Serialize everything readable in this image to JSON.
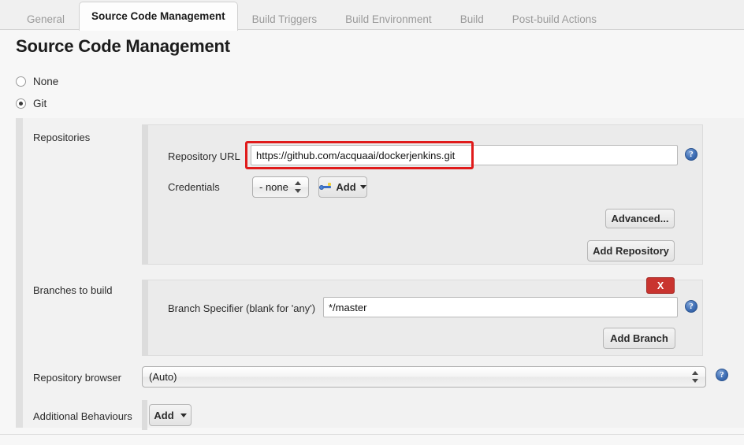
{
  "tabs": [
    {
      "label": "General",
      "active": false
    },
    {
      "label": "Source Code Management",
      "active": true
    },
    {
      "label": "Build Triggers",
      "active": false
    },
    {
      "label": "Build Environment",
      "active": false
    },
    {
      "label": "Build",
      "active": false
    },
    {
      "label": "Post-build Actions",
      "active": false
    }
  ],
  "page": {
    "title": "Source Code Management"
  },
  "scm_options": [
    {
      "label": "None",
      "selected": false
    },
    {
      "label": "Git",
      "selected": true
    }
  ],
  "repositories": {
    "section_label": "Repositories",
    "url_label": "Repository URL",
    "url_value": "https://github.com/acquaai/dockerjenkins.git",
    "credentials_label": "Credentials",
    "credentials_value": "- none -",
    "add_credentials_label": "Add",
    "advanced_label": "Advanced...",
    "add_repository_label": "Add Repository"
  },
  "branches": {
    "section_label": "Branches to build",
    "specifier_label": "Branch Specifier (blank for 'any')",
    "specifier_value": "*/master",
    "delete_label": "X",
    "add_branch_label": "Add Branch"
  },
  "repository_browser": {
    "label": "Repository browser",
    "value": "(Auto)"
  },
  "additional_behaviours": {
    "label": "Additional Behaviours",
    "add_label": "Add"
  },
  "help": {
    "glyph": "?"
  },
  "colors": {
    "annotation": "#e01b1b",
    "danger": "#c9342f",
    "help": "#3f6fb5"
  }
}
